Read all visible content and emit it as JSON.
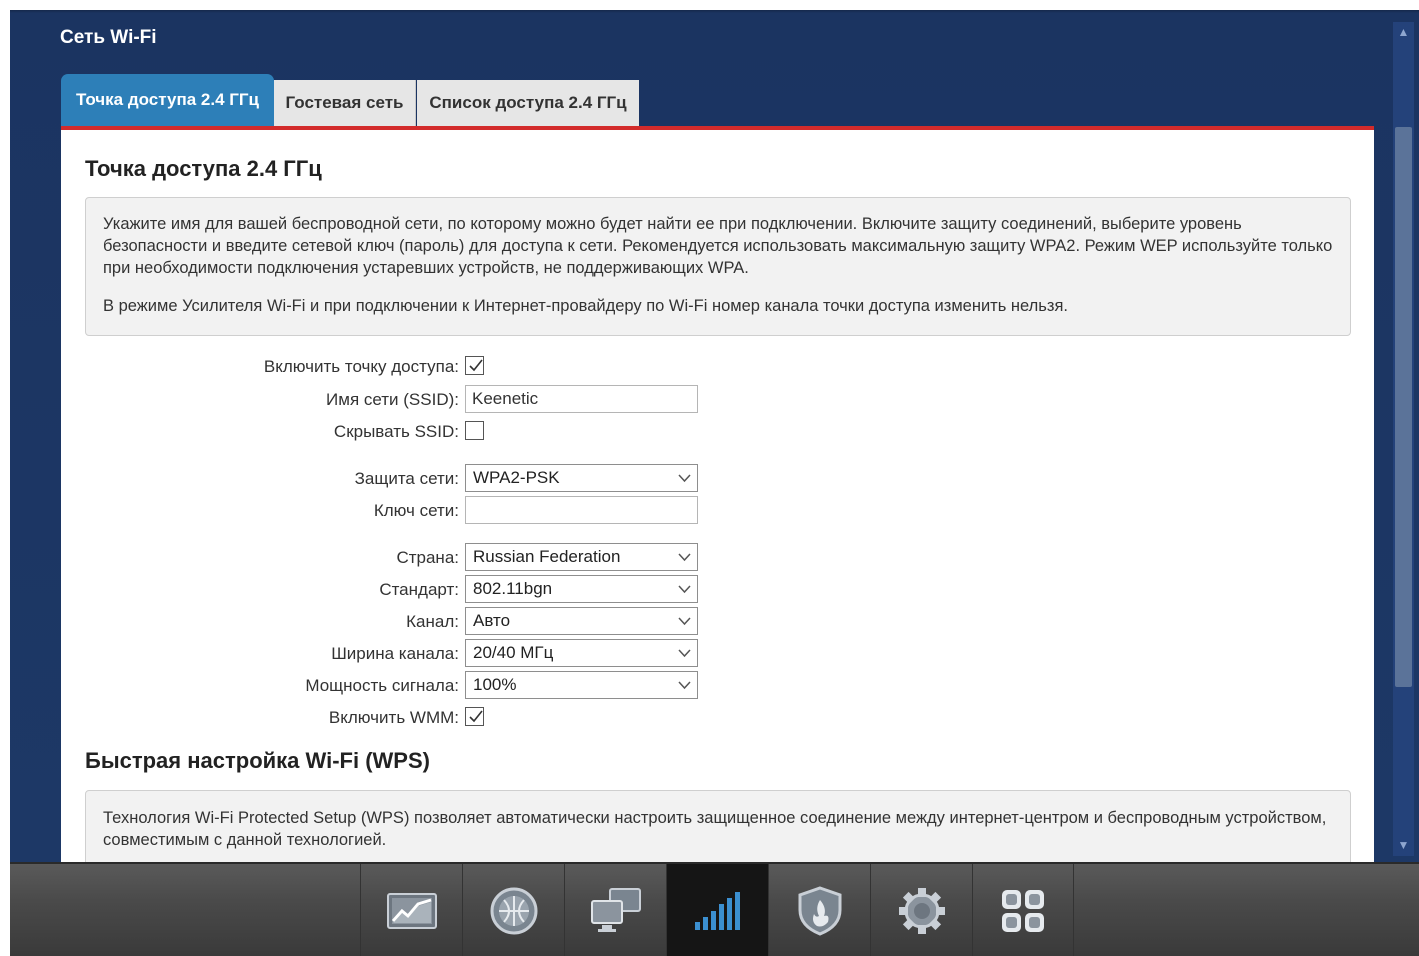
{
  "window": {
    "section_title": "Сеть Wi-Fi"
  },
  "tabs": [
    {
      "label": "Точка доступа 2.4 ГГц",
      "active": true
    },
    {
      "label": "Гостевая сеть",
      "active": false
    },
    {
      "label": "Список доступа 2.4 ГГц",
      "active": false
    }
  ],
  "content": {
    "title": "Точка доступа 2.4 ГГц",
    "info_paragraph_1": "Укажите имя для вашей беспроводной сети, по которому можно будет найти ее при подключении. Включите защиту соединений, выберите уровень безопасности и введите сетевой ключ (пароль) для доступа к сети. Рекомендуется использовать максимальную защиту WPA2. Режим WEP используйте только при необходимости подключения устаревших устройств, не поддерживающих WPA.",
    "info_paragraph_2": "В режиме Усилителя Wi-Fi и при подключении к Интернет-провайдеру по Wi-Fi номер канала точки доступа изменить нельзя."
  },
  "form": {
    "enable_ap": {
      "label": "Включить точку доступа:",
      "checked": true
    },
    "ssid": {
      "label": "Имя сети (SSID):",
      "value": "Keenetic"
    },
    "hide_ssid": {
      "label": "Скрывать SSID:",
      "checked": false
    },
    "security": {
      "label": "Защита сети:",
      "value": "WPA2-PSK"
    },
    "key": {
      "label": "Ключ сети:",
      "value": ""
    },
    "country": {
      "label": "Страна:",
      "value": "Russian Federation"
    },
    "standard": {
      "label": "Стандарт:",
      "value": "802.11bgn"
    },
    "channel": {
      "label": "Канал:",
      "value": "Авто"
    },
    "channel_width": {
      "label": "Ширина канала:",
      "value": "20/40 МГц"
    },
    "power": {
      "label": "Мощность сигнала:",
      "value": "100%"
    },
    "wmm": {
      "label": "Включить WMM:",
      "checked": true
    }
  },
  "wps": {
    "title": "Быстрая настройка Wi-Fi (WPS)",
    "info": "Технология Wi-Fi Protected Setup (WPS) позволяет автоматически настроить защищенное соединение между интернет-центром и беспроводным устройством, совместимым с данной технологией."
  },
  "taskbar": {
    "items": [
      {
        "icon": "chart-icon",
        "active": false
      },
      {
        "icon": "globe-icon",
        "active": false
      },
      {
        "icon": "network-icon",
        "active": false
      },
      {
        "icon": "wifi-signal-icon",
        "active": true
      },
      {
        "icon": "shield-icon",
        "active": false
      },
      {
        "icon": "gear-icon",
        "active": false
      },
      {
        "icon": "apps-grid-icon",
        "active": false
      }
    ]
  },
  "colors": {
    "header_bg": "#1d3866",
    "active_tab": "#2d7fb8",
    "accent_red": "#d32b2b"
  }
}
